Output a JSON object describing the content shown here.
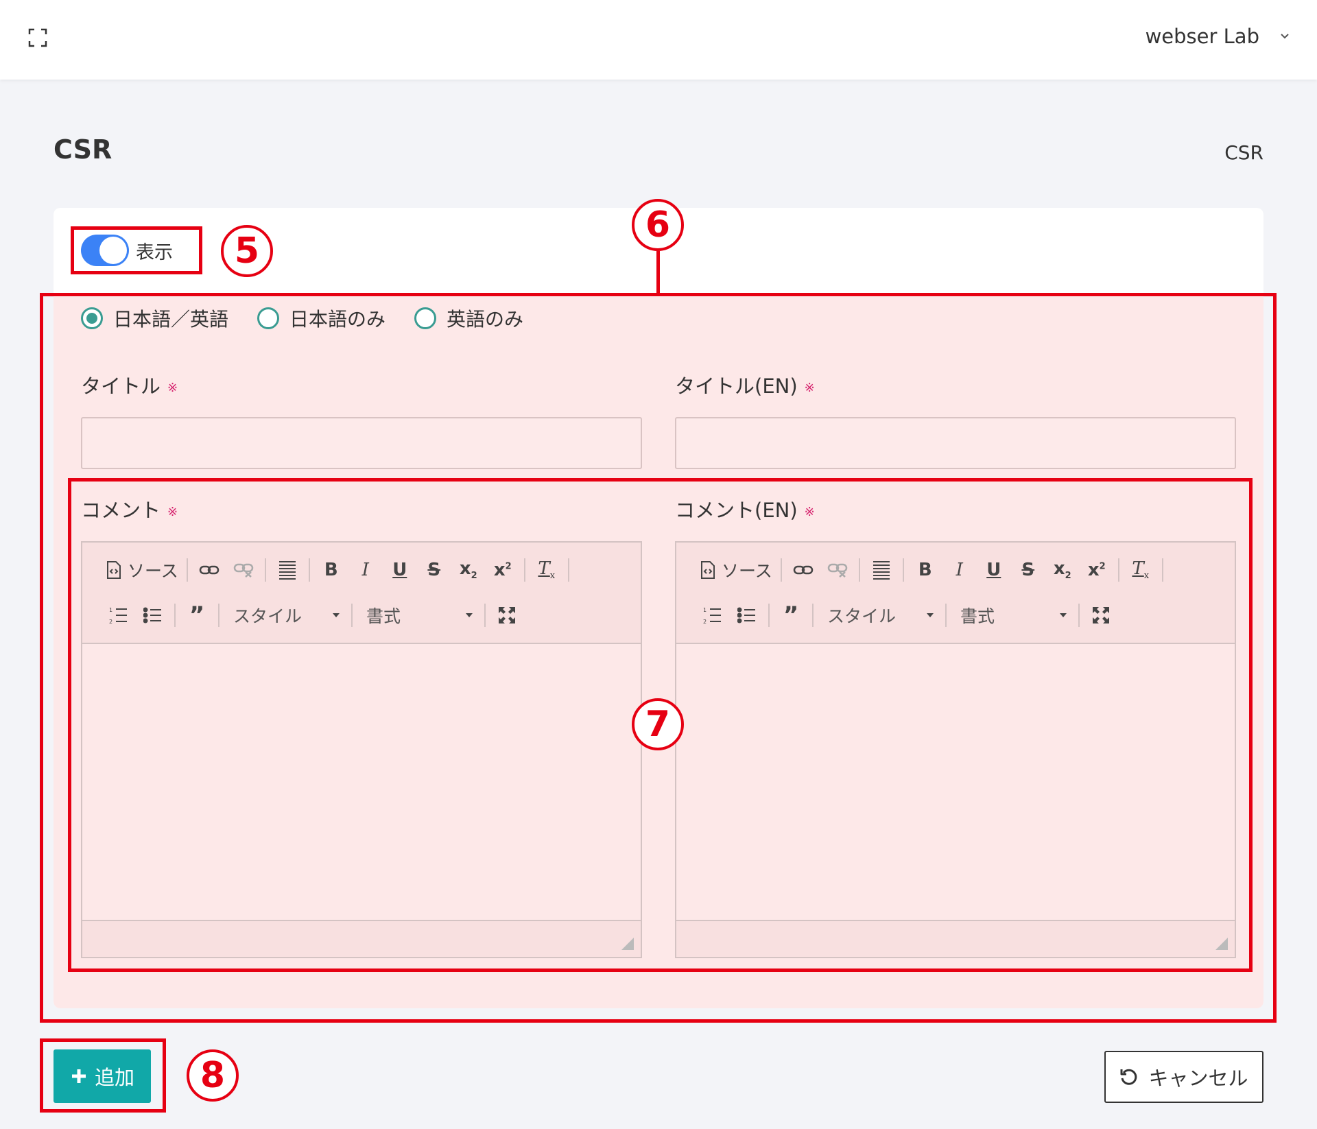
{
  "header": {
    "user_name": "webser Lab"
  },
  "page": {
    "title": "CSR",
    "breadcrumb": "CSR"
  },
  "form": {
    "display_toggle": {
      "label": "表示",
      "on": true
    },
    "language_options": [
      {
        "label": "日本語／英語",
        "checked": true
      },
      {
        "label": "日本語のみ",
        "checked": false
      },
      {
        "label": "英語のみ",
        "checked": false
      }
    ],
    "title_label": "タイトル",
    "title_en_label": "タイトル(EN)",
    "comment_label": "コメント",
    "comment_en_label": "コメント(EN)",
    "required_mark": "※",
    "title_value": "",
    "title_en_value": ""
  },
  "editor_toolbar": {
    "source_label": "ソース",
    "style_combo": "スタイル",
    "format_combo": "書式"
  },
  "actions": {
    "add_label": "追加",
    "cancel_label": "キャンセル"
  },
  "annotations": {
    "n5": "5",
    "n6": "6",
    "n7": "7",
    "n8": "8"
  },
  "colors": {
    "accent_teal": "#11a8a8",
    "toggle_blue": "#3b82f6",
    "radio_teal": "#3a9c92",
    "required_pink": "#d6246e",
    "callout_red": "#e60012",
    "highlight_pink": "#fde8e8"
  }
}
